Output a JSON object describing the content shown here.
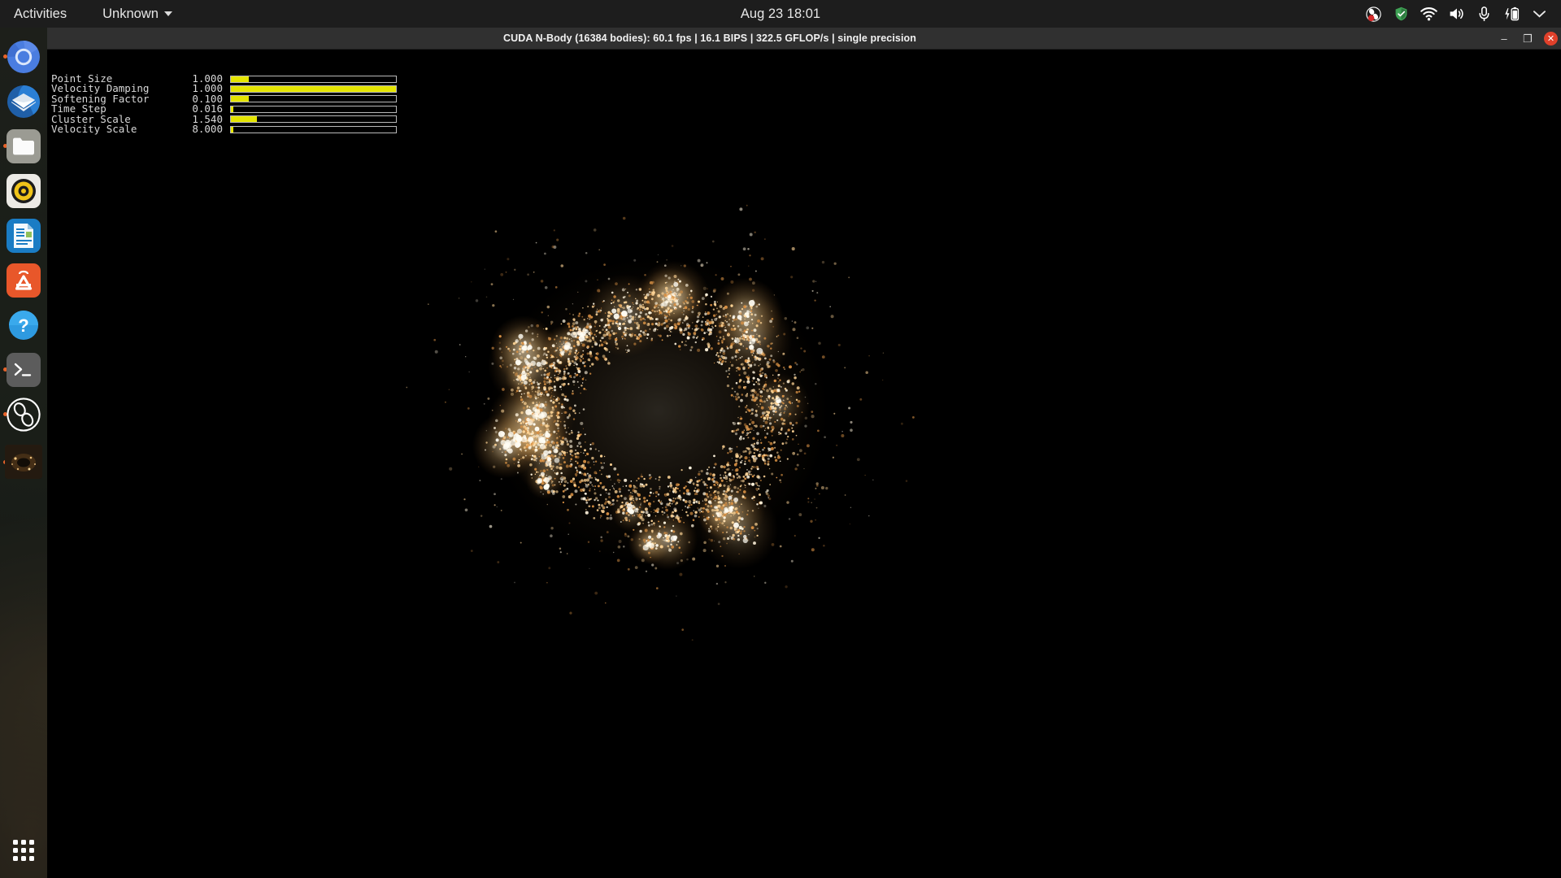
{
  "topbar": {
    "activities": "Activities",
    "app_menu": "Unknown",
    "clock": "Aug 23  18:01",
    "tray_icons": [
      {
        "name": "obs-recording-icon",
        "title": "OBS Studio recording"
      },
      {
        "name": "shield-icon",
        "title": "Security shield"
      },
      {
        "name": "wifi-icon",
        "title": "Wi-Fi"
      },
      {
        "name": "volume-icon",
        "title": "Volume"
      },
      {
        "name": "microphone-icon",
        "title": "Microphone"
      },
      {
        "name": "battery-charging-icon",
        "title": "Battery charging"
      },
      {
        "name": "chevron-down-icon",
        "title": "System menu"
      }
    ]
  },
  "dock": {
    "items": [
      {
        "name": "dock-item-chromium",
        "label": "Chromium Web Browser",
        "running": true
      },
      {
        "name": "dock-item-thunderbird",
        "label": "Thunderbird Mail",
        "running": false
      },
      {
        "name": "dock-item-files",
        "label": "Files",
        "running": true
      },
      {
        "name": "dock-item-rhythmbox",
        "label": "Rhythmbox",
        "running": false
      },
      {
        "name": "dock-item-libreoffice-writer",
        "label": "LibreOffice Writer",
        "running": false
      },
      {
        "name": "dock-item-ubuntu-software",
        "label": "Ubuntu Software",
        "running": false
      },
      {
        "name": "dock-item-help",
        "label": "Help",
        "running": false
      },
      {
        "name": "dock-item-terminal",
        "label": "Terminal",
        "running": true
      },
      {
        "name": "dock-item-obs",
        "label": "OBS Studio",
        "running": true
      },
      {
        "name": "dock-item-nbody",
        "label": "CUDA N-Body",
        "running": true
      }
    ],
    "app_grid_label": "Show Applications"
  },
  "window": {
    "title": "CUDA N-Body (16384 bodies): 60.1 fps | 16.1 BIPS | 322.5 GFLOP/s | single precision",
    "minimize_label": "–",
    "maximize_label": "❐",
    "close_label": "✕"
  },
  "simulation": {
    "bodies": "16384",
    "fps": "60.1",
    "bips": "16.1",
    "gflops": "322.5",
    "precision": "single precision",
    "particle_color": "#ffd9a0",
    "background": "#000000"
  },
  "params": {
    "fill_color": "#e4e400",
    "rows": [
      {
        "label": "Point Size",
        "value": "1.000",
        "fill_pct": 11
      },
      {
        "label": "Velocity Damping",
        "value": "1.000",
        "fill_pct": 100
      },
      {
        "label": "Softening Factor",
        "value": "0.100",
        "fill_pct": 11
      },
      {
        "label": "Time Step",
        "value": "0.016",
        "fill_pct": 1.6
      },
      {
        "label": "Cluster Scale",
        "value": "1.540",
        "fill_pct": 16
      },
      {
        "label": "Velocity Scale",
        "value": "8.000",
        "fill_pct": 1.6
      }
    ]
  }
}
